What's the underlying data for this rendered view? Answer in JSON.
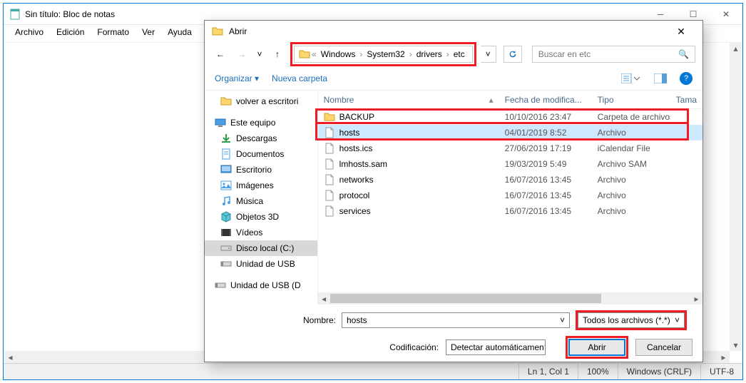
{
  "notepad": {
    "title": "Sin título: Bloc de notas",
    "menu": [
      "Archivo",
      "Edición",
      "Formato",
      "Ver",
      "Ayuda"
    ],
    "status": {
      "pos": "Ln 1, Col 1",
      "zoom": "100%",
      "eol": "Windows (CRLF)",
      "enc": "UTF-8"
    }
  },
  "dialog": {
    "title": "Abrir",
    "breadcrumb": [
      "Windows",
      "System32",
      "drivers",
      "etc"
    ],
    "search_placeholder": "Buscar en etc",
    "toolbar": {
      "organize": "Organizar",
      "new_folder": "Nueva carpeta"
    },
    "headers": {
      "name": "Nombre",
      "date": "Fecha de modifica...",
      "type": "Tipo",
      "size": "Tama"
    },
    "tree": [
      {
        "level": 2,
        "label": "volver a escritori",
        "icon": "folder"
      },
      {
        "level": 1,
        "label": "Este equipo",
        "icon": "pc"
      },
      {
        "level": 2,
        "label": "Descargas",
        "icon": "down"
      },
      {
        "level": 2,
        "label": "Documentos",
        "icon": "doc"
      },
      {
        "level": 2,
        "label": "Escritorio",
        "icon": "desk"
      },
      {
        "level": 2,
        "label": "Imágenes",
        "icon": "img"
      },
      {
        "level": 2,
        "label": "Música",
        "icon": "music"
      },
      {
        "level": 2,
        "label": "Objetos 3D",
        "icon": "obj3d"
      },
      {
        "level": 2,
        "label": "Vídeos",
        "icon": "video"
      },
      {
        "level": 2,
        "label": "Disco local (C:)",
        "icon": "drive",
        "selected": true
      },
      {
        "level": 2,
        "label": "Unidad de USB",
        "icon": "usb"
      },
      {
        "level": 1,
        "label": "Unidad de USB (D",
        "icon": "usb"
      }
    ],
    "files": [
      {
        "name": "BACKUP",
        "date": "10/10/2016 23:47",
        "type": "Carpeta de archivos",
        "icon": "folder"
      },
      {
        "name": "hosts",
        "date": "04/01/2019 8:52",
        "type": "Archivo",
        "icon": "file",
        "selected": true
      },
      {
        "name": "hosts.ics",
        "date": "27/06/2019 17:19",
        "type": "iCalendar File",
        "icon": "file"
      },
      {
        "name": "lmhosts.sam",
        "date": "19/03/2019 5:49",
        "type": "Archivo SAM",
        "icon": "file"
      },
      {
        "name": "networks",
        "date": "16/07/2016 13:45",
        "type": "Archivo",
        "icon": "file"
      },
      {
        "name": "protocol",
        "date": "16/07/2016 13:45",
        "type": "Archivo",
        "icon": "file"
      },
      {
        "name": "services",
        "date": "16/07/2016 13:45",
        "type": "Archivo",
        "icon": "file"
      }
    ],
    "filename_label": "Nombre:",
    "filename_value": "hosts",
    "filetype_value": "Todos los archivos (*.*)",
    "encoding_label": "Codificación:",
    "encoding_value": "Detectar automáticamen",
    "open_btn": "Abrir",
    "cancel_btn": "Cancelar"
  }
}
